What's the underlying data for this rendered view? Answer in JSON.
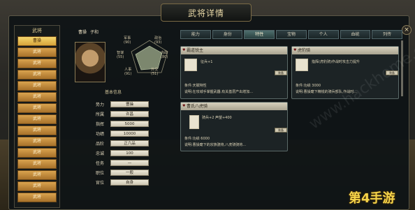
{
  "title": "武将详情",
  "close_label": "×",
  "sidebar": {
    "header": "武将",
    "items": [
      "曹操",
      "武将",
      "武将",
      "武将",
      "武将",
      "武将",
      "武将",
      "武将",
      "武将",
      "武将",
      "武将",
      "武将",
      "武将",
      "武将",
      "武将",
      "武将"
    ]
  },
  "general": {
    "name": "曹操",
    "courtesy": "子和",
    "stats": {
      "army_label": "军事",
      "army": "(90)",
      "politics_label": "政治",
      "politics": "(93)",
      "wisdom_label": "智谋",
      "wisdom": "(55)",
      "affairs_label": "内政",
      "affairs": "(80)",
      "personnel_label": "人事",
      "personnel": "(91)",
      "diplomacy_label": "外交",
      "diplomacy": "(51)"
    }
  },
  "basic": {
    "title": "基本信息",
    "rows": [
      {
        "k": "势力",
        "v": "曹操"
      },
      {
        "k": "所属",
        "v": "许昌"
      },
      {
        "k": "指挥",
        "v": "5000"
      },
      {
        "k": "功绩",
        "v": "10000"
      },
      {
        "k": "品阶",
        "v": "正六品"
      },
      {
        "k": "忠诚",
        "v": "100"
      },
      {
        "k": "任务",
        "v": "—"
      },
      {
        "k": "职位",
        "v": "一般"
      },
      {
        "k": "官位",
        "v": "自身"
      }
    ]
  },
  "tabs": [
    "能力",
    "身份",
    "特性",
    "宝物",
    "个人",
    "血统",
    "列传"
  ],
  "selected_tab": 2,
  "panels": {
    "p1_title": "霸道锐主",
    "p1_text": "征兵+1",
    "p1_cond": "条件:天赋特性",
    "p1_desc": "说明:在攻城手掌握武器,有关基层产出增加...",
    "p1_btn": "装备",
    "p2_title": "虎豹骑",
    "p2_text": "指挥(虎豹骑)作战时攻击力提升",
    "p2_cond": "条件:功绩 3000",
    "p2_desc": "说明:曹操麾下精锐的骑兵部队,作战时...",
    "p2_btn": "装备",
    "p3_title": "曹氏八虎骑",
    "p3_text": "骑兵+2 声望+400",
    "p3_cond": "条件:功绩 6000",
    "p3_desc": "说明:曹操麾下的宗族骁将,八虎骑骑将...",
    "p3_btn": "装备"
  },
  "watermark": "www.hackhome.com",
  "logo_text": "第4手游"
}
